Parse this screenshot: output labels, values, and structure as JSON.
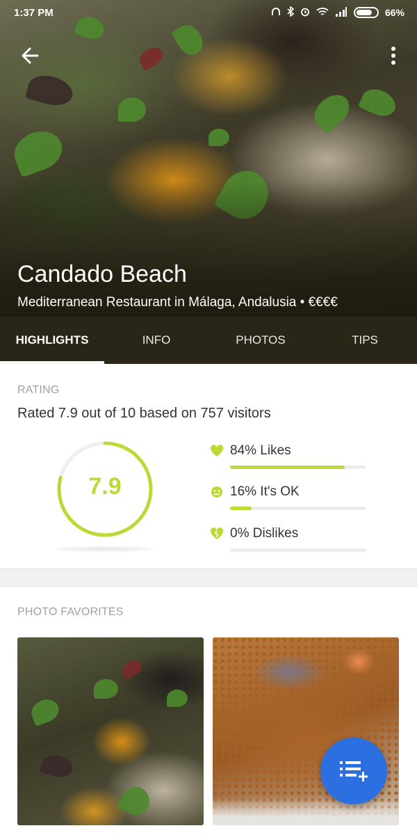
{
  "status_bar": {
    "time": "1:37 PM",
    "battery": "66%"
  },
  "venue": {
    "name": "Candado Beach",
    "subtitle": "Mediterranean Restaurant in Málaga, Andalusia • €€€€"
  },
  "tabs": [
    {
      "label": "HIGHLIGHTS",
      "active": true
    },
    {
      "label": "INFO",
      "active": false
    },
    {
      "label": "PHOTOS",
      "active": false
    },
    {
      "label": "TIPS",
      "active": false
    }
  ],
  "rating": {
    "section_label": "RATING",
    "description": "Rated 7.9 out of 10 based on 757 visitors",
    "score": "7.9",
    "score_fraction": 0.79,
    "accent_color": "#bfd837",
    "breakdown": [
      {
        "label": "84% Likes",
        "icon": "heart-icon",
        "fraction": 0.84
      },
      {
        "label": "16% It's OK",
        "icon": "neutral-face-icon",
        "fraction": 0.16
      },
      {
        "label": "0% Dislikes",
        "icon": "broken-heart-icon",
        "fraction": 0.0
      }
    ]
  },
  "photo_favorites": {
    "section_label": "PHOTO FAVORITES",
    "photos": [
      {
        "subject": "microgreens-on-sardines"
      },
      {
        "subject": "paella-with-fish-and-shrimp"
      }
    ]
  },
  "fab": {
    "icon": "add-to-list-icon",
    "color": "#2c6fe0"
  }
}
